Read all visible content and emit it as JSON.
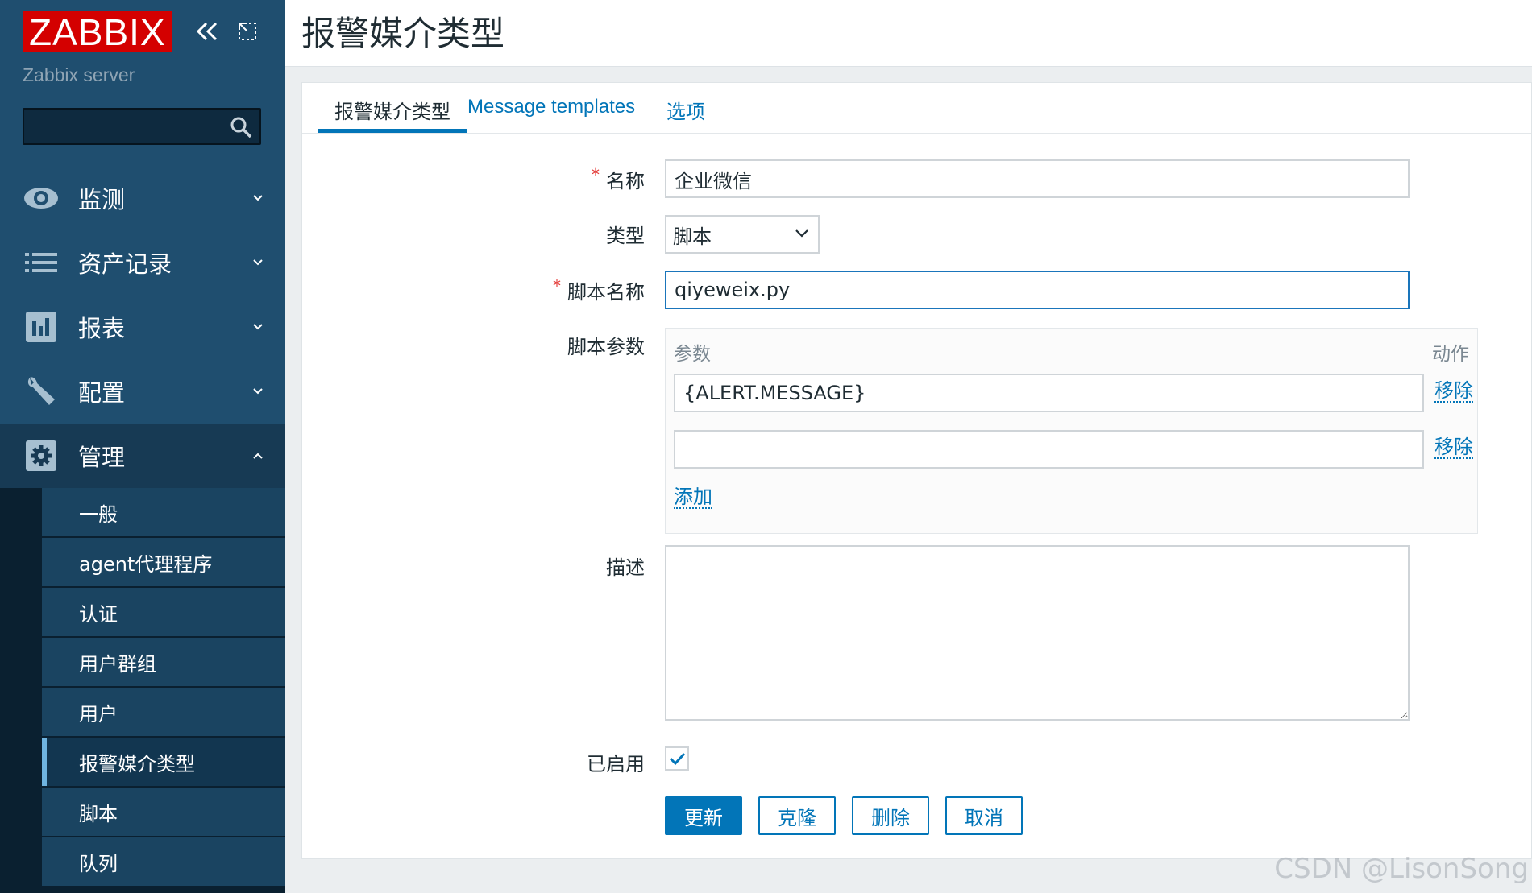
{
  "sidebar": {
    "logo": "ZABBIX",
    "server_name": "Zabbix server",
    "search_value": "",
    "menu": [
      {
        "label": "监测",
        "icon": "eye-icon"
      },
      {
        "label": "资产记录",
        "icon": "list-icon"
      },
      {
        "label": "报表",
        "icon": "bar-chart-icon"
      },
      {
        "label": "配置",
        "icon": "wrench-icon"
      },
      {
        "label": "管理",
        "icon": "gear-icon"
      }
    ],
    "submenu": [
      {
        "label": "一般"
      },
      {
        "label": "agent代理程序"
      },
      {
        "label": "认证"
      },
      {
        "label": "用户群组"
      },
      {
        "label": "用户"
      },
      {
        "label": "报警媒介类型"
      },
      {
        "label": "脚本"
      },
      {
        "label": "队列"
      }
    ]
  },
  "header": {
    "title": "报警媒介类型"
  },
  "tabs": [
    {
      "label": "报警媒介类型"
    },
    {
      "label": "Message templates"
    },
    {
      "label": "选项"
    }
  ],
  "form": {
    "name_label": "名称",
    "name_value": "企业微信",
    "type_label": "类型",
    "type_value": "脚本",
    "script_name_label": "脚本名称",
    "script_name_value": "qiyeweix.py",
    "params_label": "脚本参数",
    "params_col_param": "参数",
    "params_col_action": "动作",
    "params": [
      {
        "value": "{ALERT.MESSAGE}",
        "remove": "移除"
      },
      {
        "value": "",
        "remove": "移除"
      }
    ],
    "add_link": "添加",
    "desc_label": "描述",
    "desc_value": "",
    "enabled_label": "已启用",
    "enabled": true,
    "required_mark": "*"
  },
  "buttons": {
    "update": "更新",
    "clone": "克隆",
    "delete": "删除",
    "cancel": "取消"
  },
  "watermark": "CSDN @LisonSong"
}
